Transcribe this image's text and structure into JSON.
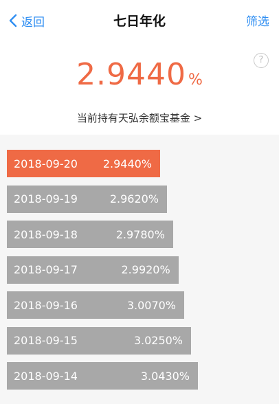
{
  "nav": {
    "back_label": "返回",
    "title": "七日年化",
    "filter_label": "筛选"
  },
  "help_glyph": "?",
  "rate": {
    "value": "2.9440",
    "unit": "%"
  },
  "fund_link": "当前持有天弘余额宝基金 >",
  "colors": {
    "accent": "#ef6a45",
    "bar_grey": "#a8a8a8",
    "link_blue": "#2f8ef2"
  },
  "rows": [
    {
      "date": "2018-09-20",
      "value": "2.9440%",
      "selected": true
    },
    {
      "date": "2018-09-19",
      "value": "2.9620%",
      "selected": false
    },
    {
      "date": "2018-09-18",
      "value": "2.9780%",
      "selected": false
    },
    {
      "date": "2018-09-17",
      "value": "2.9920%",
      "selected": false
    },
    {
      "date": "2018-09-16",
      "value": "3.0070%",
      "selected": false
    },
    {
      "date": "2018-09-15",
      "value": "3.0250%",
      "selected": false
    },
    {
      "date": "2018-09-14",
      "value": "3.0430%",
      "selected": false
    }
  ]
}
